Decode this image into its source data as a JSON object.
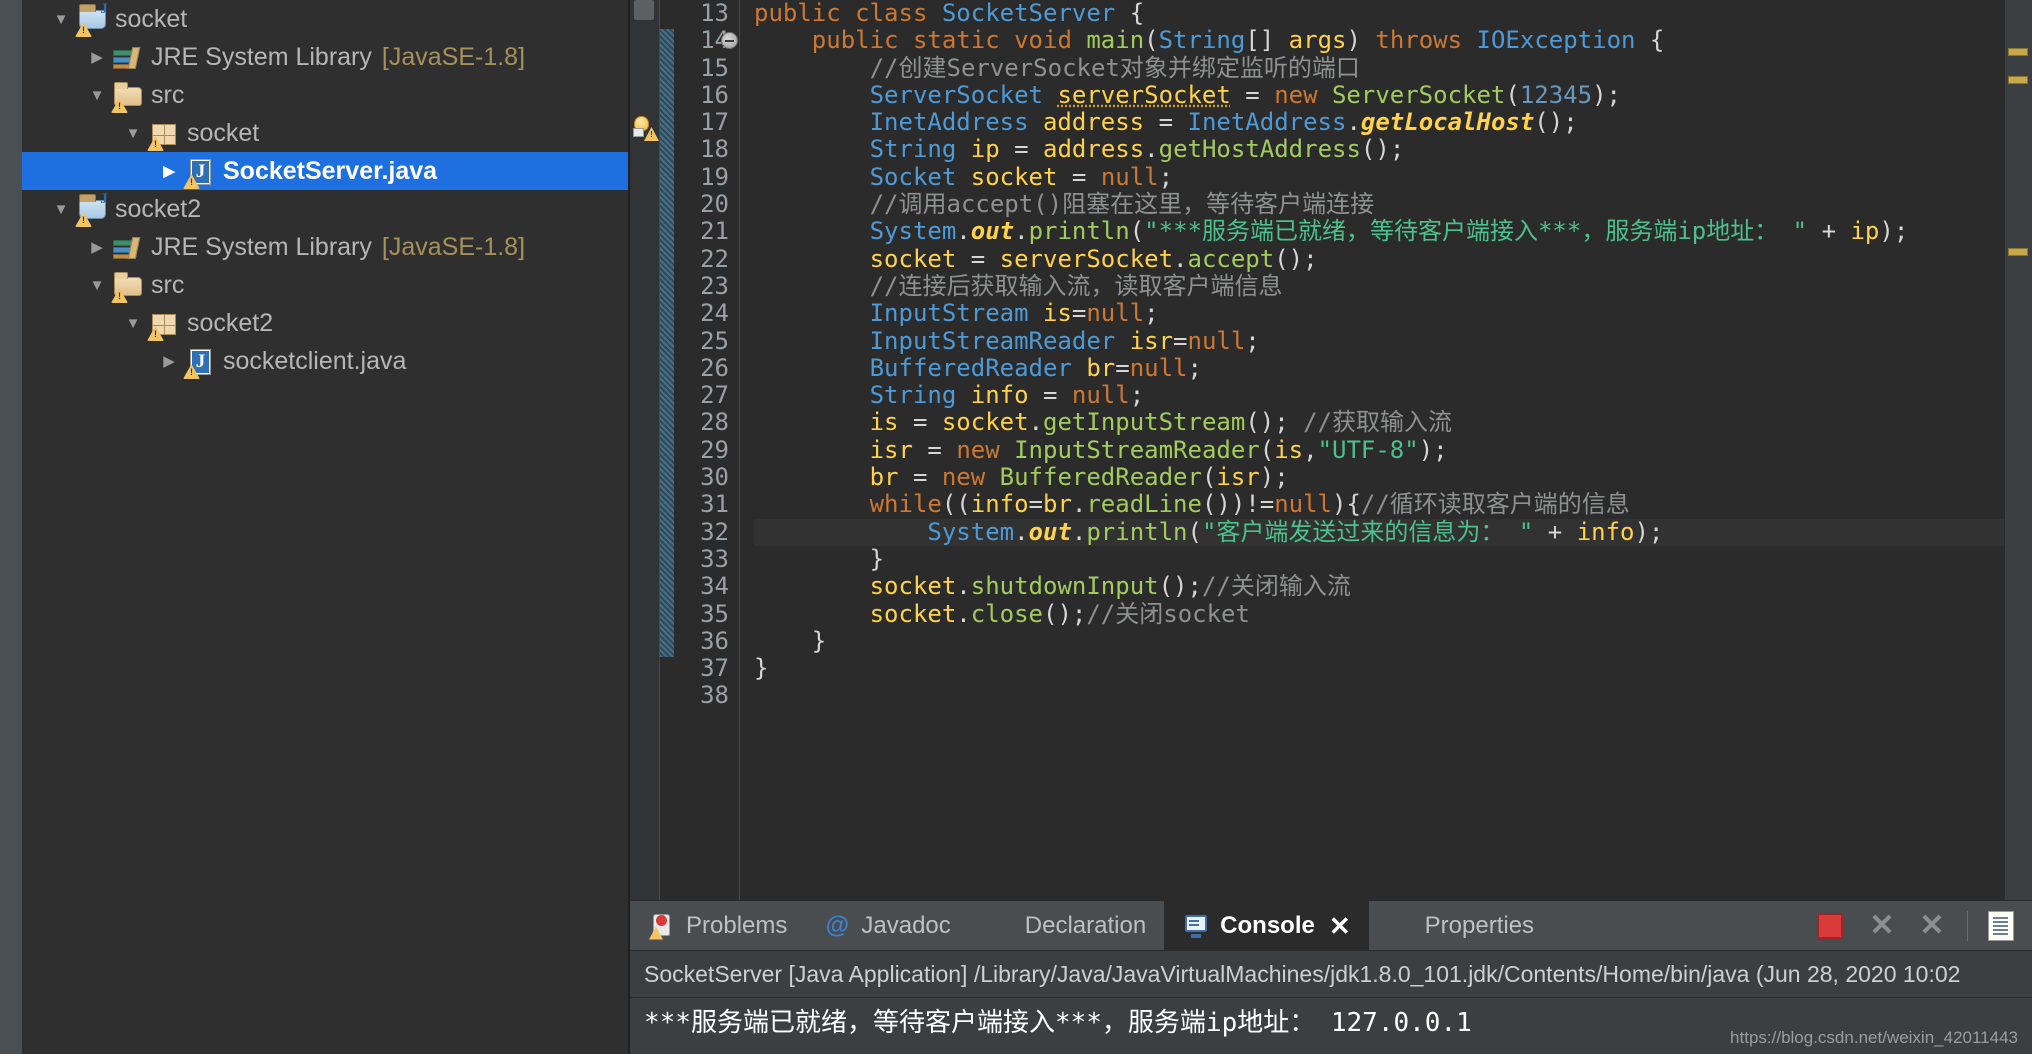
{
  "explorer": {
    "name": "package-explorer",
    "tree": [
      {
        "label": "socket",
        "suffix": "",
        "icon": "java-project-icon",
        "arrow": "down",
        "indent": 0,
        "selected": false,
        "warn": true
      },
      {
        "label": "JRE System Library",
        "suffix": "[JavaSE-1.8]",
        "icon": "jre-library-icon",
        "arrow": "right",
        "indent": 1,
        "selected": false,
        "warn": false
      },
      {
        "label": "src",
        "suffix": "",
        "icon": "source-folder-icon",
        "arrow": "down",
        "indent": 1,
        "selected": false,
        "warn": true
      },
      {
        "label": "socket",
        "suffix": "",
        "icon": "package-icon",
        "arrow": "down",
        "indent": 2,
        "selected": false,
        "warn": true
      },
      {
        "label": "SocketServer.java",
        "suffix": "",
        "icon": "java-file-icon",
        "arrow": "right",
        "indent": 3,
        "selected": true,
        "warn": true
      },
      {
        "label": "socket2",
        "suffix": "",
        "icon": "java-project-icon",
        "arrow": "down",
        "indent": 0,
        "selected": false,
        "warn": true
      },
      {
        "label": "JRE System Library",
        "suffix": "[JavaSE-1.8]",
        "icon": "jre-library-icon",
        "arrow": "right",
        "indent": 1,
        "selected": false,
        "warn": false
      },
      {
        "label": "src",
        "suffix": "",
        "icon": "source-folder-icon",
        "arrow": "down",
        "indent": 1,
        "selected": false,
        "warn": true
      },
      {
        "label": "socket2",
        "suffix": "",
        "icon": "package-icon",
        "arrow": "down",
        "indent": 2,
        "selected": false,
        "warn": true
      },
      {
        "label": "socketclient.java",
        "suffix": "",
        "icon": "java-file-icon",
        "arrow": "right",
        "indent": 3,
        "selected": false,
        "warn": true
      }
    ]
  },
  "editor": {
    "name": "java-source-editor",
    "first_line": 13,
    "lines": [
      {
        "n": 13,
        "tokens": [
          {
            "t": "k",
            "x": "public "
          },
          {
            "t": "k",
            "x": "class "
          },
          {
            "t": "t",
            "x": "SocketServer"
          },
          {
            "t": "p",
            "x": " {"
          }
        ]
      },
      {
        "n": 14,
        "fold": true,
        "tokens": [
          {
            "t": "p",
            "x": "    "
          },
          {
            "t": "k",
            "x": "public "
          },
          {
            "t": "k",
            "x": "static "
          },
          {
            "t": "k",
            "x": "void "
          },
          {
            "t": "m",
            "x": "main"
          },
          {
            "t": "p",
            "x": "("
          },
          {
            "t": "t",
            "x": "String"
          },
          {
            "t": "p",
            "x": "[] "
          },
          {
            "t": "v",
            "x": "args"
          },
          {
            "t": "p",
            "x": ") "
          },
          {
            "t": "k",
            "x": "throws "
          },
          {
            "t": "t",
            "x": "IOException"
          },
          {
            "t": "p",
            "x": " {"
          }
        ]
      },
      {
        "n": 15,
        "tokens": [
          {
            "t": "c",
            "x": "        //创建ServerSocket对象并绑定监听的端口"
          }
        ]
      },
      {
        "n": 16,
        "tokens": [
          {
            "t": "p",
            "x": "        "
          },
          {
            "t": "t",
            "x": "ServerSocket "
          },
          {
            "t": "vu",
            "x": "serverSocket"
          },
          {
            "t": "p",
            "x": " = "
          },
          {
            "t": "k",
            "x": "new "
          },
          {
            "t": "m",
            "x": "ServerSocket"
          },
          {
            "t": "p",
            "x": "("
          },
          {
            "t": "n",
            "x": "12345"
          },
          {
            "t": "p",
            "x": ");"
          }
        ]
      },
      {
        "n": 17,
        "tokens": [
          {
            "t": "p",
            "x": "        "
          },
          {
            "t": "t",
            "x": "InetAddress "
          },
          {
            "t": "v",
            "x": "address"
          },
          {
            "t": "p",
            "x": " = "
          },
          {
            "t": "t",
            "x": "InetAddress"
          },
          {
            "t": "p",
            "x": "."
          },
          {
            "t": "f",
            "x": "getLocalHost"
          },
          {
            "t": "p",
            "x": "();"
          }
        ]
      },
      {
        "n": 18,
        "tokens": [
          {
            "t": "p",
            "x": "        "
          },
          {
            "t": "t",
            "x": "String "
          },
          {
            "t": "v",
            "x": "ip"
          },
          {
            "t": "p",
            "x": " = "
          },
          {
            "t": "v",
            "x": "address"
          },
          {
            "t": "p",
            "x": "."
          },
          {
            "t": "m",
            "x": "getHostAddress"
          },
          {
            "t": "p",
            "x": "();"
          }
        ]
      },
      {
        "n": 19,
        "tokens": [
          {
            "t": "p",
            "x": "        "
          },
          {
            "t": "t",
            "x": "Socket "
          },
          {
            "t": "v",
            "x": "socket"
          },
          {
            "t": "p",
            "x": " = "
          },
          {
            "t": "k",
            "x": "null"
          },
          {
            "t": "p",
            "x": ";"
          }
        ]
      },
      {
        "n": 20,
        "tokens": [
          {
            "t": "c",
            "x": "        //调用accept()阻塞在这里，等待客户端连接"
          }
        ]
      },
      {
        "n": 21,
        "tokens": [
          {
            "t": "p",
            "x": "        "
          },
          {
            "t": "t",
            "x": "System"
          },
          {
            "t": "p",
            "x": "."
          },
          {
            "t": "f",
            "x": "out"
          },
          {
            "t": "p",
            "x": "."
          },
          {
            "t": "m",
            "x": "println"
          },
          {
            "t": "p",
            "x": "("
          },
          {
            "t": "s",
            "x": "\"***服务端已就绪，等待客户端接入***，服务端ip地址： \""
          },
          {
            "t": "p",
            "x": " + "
          },
          {
            "t": "v",
            "x": "ip"
          },
          {
            "t": "p",
            "x": ");"
          }
        ]
      },
      {
        "n": 22,
        "tokens": [
          {
            "t": "p",
            "x": "        "
          },
          {
            "t": "v",
            "x": "socket"
          },
          {
            "t": "p",
            "x": " = "
          },
          {
            "t": "v",
            "x": "serverSocket"
          },
          {
            "t": "p",
            "x": "."
          },
          {
            "t": "m",
            "x": "accept"
          },
          {
            "t": "p",
            "x": "();"
          }
        ]
      },
      {
        "n": 23,
        "tokens": [
          {
            "t": "c",
            "x": "        //连接后获取输入流，读取客户端信息"
          }
        ]
      },
      {
        "n": 24,
        "tokens": [
          {
            "t": "p",
            "x": "        "
          },
          {
            "t": "t",
            "x": "InputStream "
          },
          {
            "t": "v",
            "x": "is"
          },
          {
            "t": "p",
            "x": "="
          },
          {
            "t": "k",
            "x": "null"
          },
          {
            "t": "p",
            "x": ";"
          }
        ]
      },
      {
        "n": 25,
        "tokens": [
          {
            "t": "p",
            "x": "        "
          },
          {
            "t": "t",
            "x": "InputStreamReader "
          },
          {
            "t": "v",
            "x": "isr"
          },
          {
            "t": "p",
            "x": "="
          },
          {
            "t": "k",
            "x": "null"
          },
          {
            "t": "p",
            "x": ";"
          }
        ]
      },
      {
        "n": 26,
        "tokens": [
          {
            "t": "p",
            "x": "        "
          },
          {
            "t": "t",
            "x": "BufferedReader "
          },
          {
            "t": "v",
            "x": "br"
          },
          {
            "t": "p",
            "x": "="
          },
          {
            "t": "k",
            "x": "null"
          },
          {
            "t": "p",
            "x": ";"
          }
        ]
      },
      {
        "n": 27,
        "tokens": [
          {
            "t": "p",
            "x": "        "
          },
          {
            "t": "t",
            "x": "String "
          },
          {
            "t": "v",
            "x": "info"
          },
          {
            "t": "p",
            "x": " = "
          },
          {
            "t": "k",
            "x": "null"
          },
          {
            "t": "p",
            "x": ";"
          }
        ]
      },
      {
        "n": 28,
        "tokens": [
          {
            "t": "p",
            "x": "        "
          },
          {
            "t": "v",
            "x": "is"
          },
          {
            "t": "p",
            "x": " = "
          },
          {
            "t": "v",
            "x": "socket"
          },
          {
            "t": "p",
            "x": "."
          },
          {
            "t": "m",
            "x": "getInputStream"
          },
          {
            "t": "p",
            "x": "(); "
          },
          {
            "t": "c",
            "x": "//获取输入流"
          }
        ]
      },
      {
        "n": 29,
        "tokens": [
          {
            "t": "p",
            "x": "        "
          },
          {
            "t": "v",
            "x": "isr"
          },
          {
            "t": "p",
            "x": " = "
          },
          {
            "t": "k",
            "x": "new "
          },
          {
            "t": "m",
            "x": "InputStreamReader"
          },
          {
            "t": "p",
            "x": "("
          },
          {
            "t": "v",
            "x": "is"
          },
          {
            "t": "p",
            "x": ","
          },
          {
            "t": "s",
            "x": "\"UTF-8\""
          },
          {
            "t": "p",
            "x": ");"
          }
        ]
      },
      {
        "n": 30,
        "tokens": [
          {
            "t": "p",
            "x": "        "
          },
          {
            "t": "v",
            "x": "br"
          },
          {
            "t": "p",
            "x": " = "
          },
          {
            "t": "k",
            "x": "new "
          },
          {
            "t": "m",
            "x": "BufferedReader"
          },
          {
            "t": "p",
            "x": "("
          },
          {
            "t": "v",
            "x": "isr"
          },
          {
            "t": "p",
            "x": ");"
          }
        ]
      },
      {
        "n": 31,
        "tokens": [
          {
            "t": "p",
            "x": "        "
          },
          {
            "t": "k",
            "x": "while"
          },
          {
            "t": "p",
            "x": "(("
          },
          {
            "t": "v",
            "x": "info"
          },
          {
            "t": "p",
            "x": "="
          },
          {
            "t": "v",
            "x": "br"
          },
          {
            "t": "p",
            "x": "."
          },
          {
            "t": "m",
            "x": "readLine"
          },
          {
            "t": "p",
            "x": "())!="
          },
          {
            "t": "k",
            "x": "null"
          },
          {
            "t": "p",
            "x": "){"
          },
          {
            "t": "c",
            "x": "//循环读取客户端的信息"
          }
        ]
      },
      {
        "n": 32,
        "highlight": true,
        "tokens": [
          {
            "t": "p",
            "x": "            "
          },
          {
            "t": "t",
            "x": "System"
          },
          {
            "t": "p",
            "x": "."
          },
          {
            "t": "f",
            "x": "out"
          },
          {
            "t": "p",
            "x": "."
          },
          {
            "t": "m",
            "x": "println"
          },
          {
            "t": "p",
            "x": "("
          },
          {
            "t": "s",
            "x": "\"客户端发送过来的信息为： \""
          },
          {
            "t": "p",
            "x": " + "
          },
          {
            "t": "v",
            "x": "info"
          },
          {
            "t": "p",
            "x": ");"
          }
        ]
      },
      {
        "n": 33,
        "tokens": [
          {
            "t": "p",
            "x": "        }"
          }
        ]
      },
      {
        "n": 34,
        "tokens": [
          {
            "t": "p",
            "x": "        "
          },
          {
            "t": "v",
            "x": "socket"
          },
          {
            "t": "p",
            "x": "."
          },
          {
            "t": "m",
            "x": "shutdownInput"
          },
          {
            "t": "p",
            "x": "();"
          },
          {
            "t": "c",
            "x": "//关闭输入流"
          }
        ]
      },
      {
        "n": 35,
        "tokens": [
          {
            "t": "p",
            "x": "        "
          },
          {
            "t": "v",
            "x": "socket"
          },
          {
            "t": "p",
            "x": "."
          },
          {
            "t": "m",
            "x": "close"
          },
          {
            "t": "p",
            "x": "();"
          },
          {
            "t": "c",
            "x": "//关闭socket"
          }
        ]
      },
      {
        "n": 36,
        "tokens": [
          {
            "t": "p",
            "x": "    }"
          }
        ]
      },
      {
        "n": 37,
        "tokens": [
          {
            "t": "p",
            "x": "}"
          }
        ]
      },
      {
        "n": 38,
        "tokens": []
      }
    ]
  },
  "bottom_panel": {
    "tabs": [
      {
        "label": "Problems",
        "icon": "problems-icon",
        "active": false,
        "closable": false
      },
      {
        "label": "Javadoc",
        "icon": "javadoc-icon",
        "active": false,
        "closable": false
      },
      {
        "label": "Declaration",
        "icon": "declaration-icon",
        "active": false,
        "closable": false
      },
      {
        "label": "Console",
        "icon": "console-icon",
        "active": true,
        "closable": true,
        "close_glyph": "✕"
      },
      {
        "label": "Properties",
        "icon": "properties-icon",
        "active": false,
        "closable": false
      }
    ],
    "toolbar": [
      {
        "name": "terminate-button",
        "icon": "stop-icon",
        "glyph": ""
      },
      {
        "name": "remove-launch-button",
        "icon": "close-x-icon",
        "glyph": "✕"
      },
      {
        "name": "remove-all-terminated-button",
        "icon": "close-all-x-icon",
        "glyph": "✕"
      },
      {
        "name": "open-console-button",
        "icon": "document-icon",
        "glyph": ""
      }
    ],
    "launch_line": "SocketServer [Java Application] /Library/Java/JavaVirtualMachines/jdk1.8.0_101.jdk/Contents/Home/bin/java  (Jun 28, 2020 10:02",
    "console_output": [
      "***服务端已就绪，等待客户端接入***，服务端ip地址： 127.0.0.1"
    ],
    "watermark": "https://blog.csdn.net/weixin_42011443"
  },
  "colors": {
    "accent_selection": "#1e6fe0",
    "editor_bg": "#2b2b2b",
    "panel_bg": "#3c3f41",
    "keyword": "#cc7832",
    "type": "#4e9ad6",
    "variable": "#ffd24a",
    "method": "#a2cc5e",
    "string": "#4cc08d",
    "comment": "#8e918f",
    "number": "#6897bb",
    "stop_red": "#d93b3b"
  }
}
